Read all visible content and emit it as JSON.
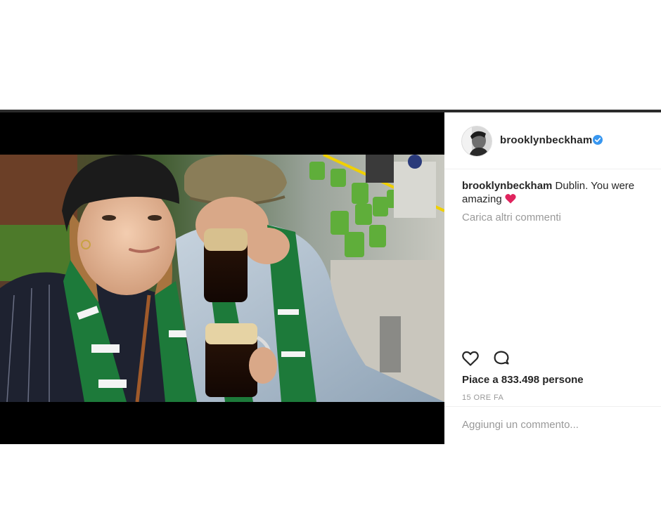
{
  "post": {
    "author": {
      "username": "brooklynbeckham",
      "verified": true,
      "verified_color": "#3897f0"
    },
    "caption": {
      "username": "brooklynbeckham",
      "text": "Dublin. You were amazing",
      "emoji": "red-heart"
    },
    "load_more_label": "Carica altri commenti",
    "actions": {
      "like_icon": "heart-outline-icon",
      "comment_icon": "speech-bubble-icon"
    },
    "likes_text": "Piace a 833.498 persone",
    "timestamp": "15 ORE FA",
    "comment_placeholder": "Aggiungi un commento..."
  },
  "colors": {
    "text_primary": "#262626",
    "text_secondary": "#999999",
    "divider": "#efefef",
    "media_background": "#000000",
    "heart_emoji": "#e0245e"
  }
}
